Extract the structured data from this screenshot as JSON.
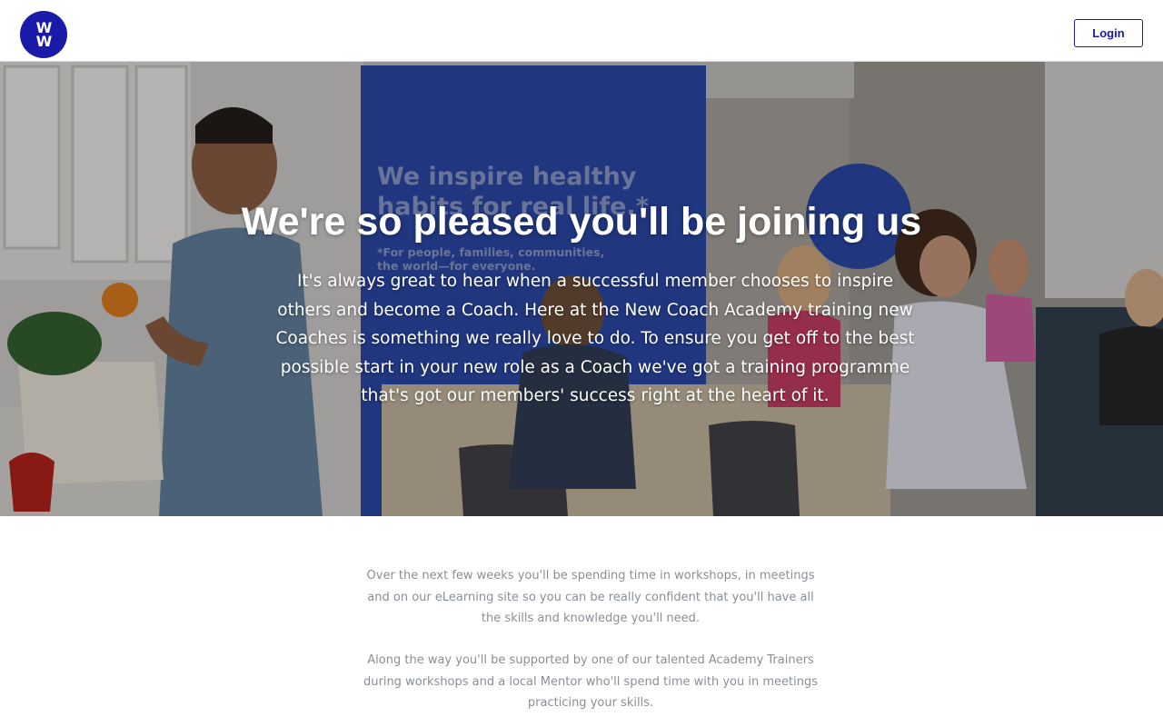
{
  "header": {
    "logo_text": "WW",
    "logo_line1": "W",
    "logo_line2": "W",
    "login_label": "Login",
    "brand_color": "#1a1aa8"
  },
  "hero": {
    "title": "We're so pleased you'll be joining us",
    "body": "It's always great to hear when a successful member chooses to inspire others and become a Coach. Here at the New Coach Academy training new Coaches is something we really love to do. To ensure you get off to the best possible start in your new role as a Coach we've got a training programme that's got our members' success right at the heart of it.",
    "banner_line1": "We inspire healthy",
    "banner_line2": "habits for real life.*",
    "banner_footnote1": "*For people, families, communities,",
    "banner_footnote2": "the world—for everyone."
  },
  "content": {
    "paragraph1": "Over the next few weeks you'll be spending time in workshops, in meetings and on our eLearning site so you can be really confident that you'll have all the skills and knowledge you'll need.",
    "paragraph2": "Along the way you'll be supported by one of our talented Academy Trainers during workshops and a local Mentor who'll spend time with you in meetings practicing your skills."
  }
}
